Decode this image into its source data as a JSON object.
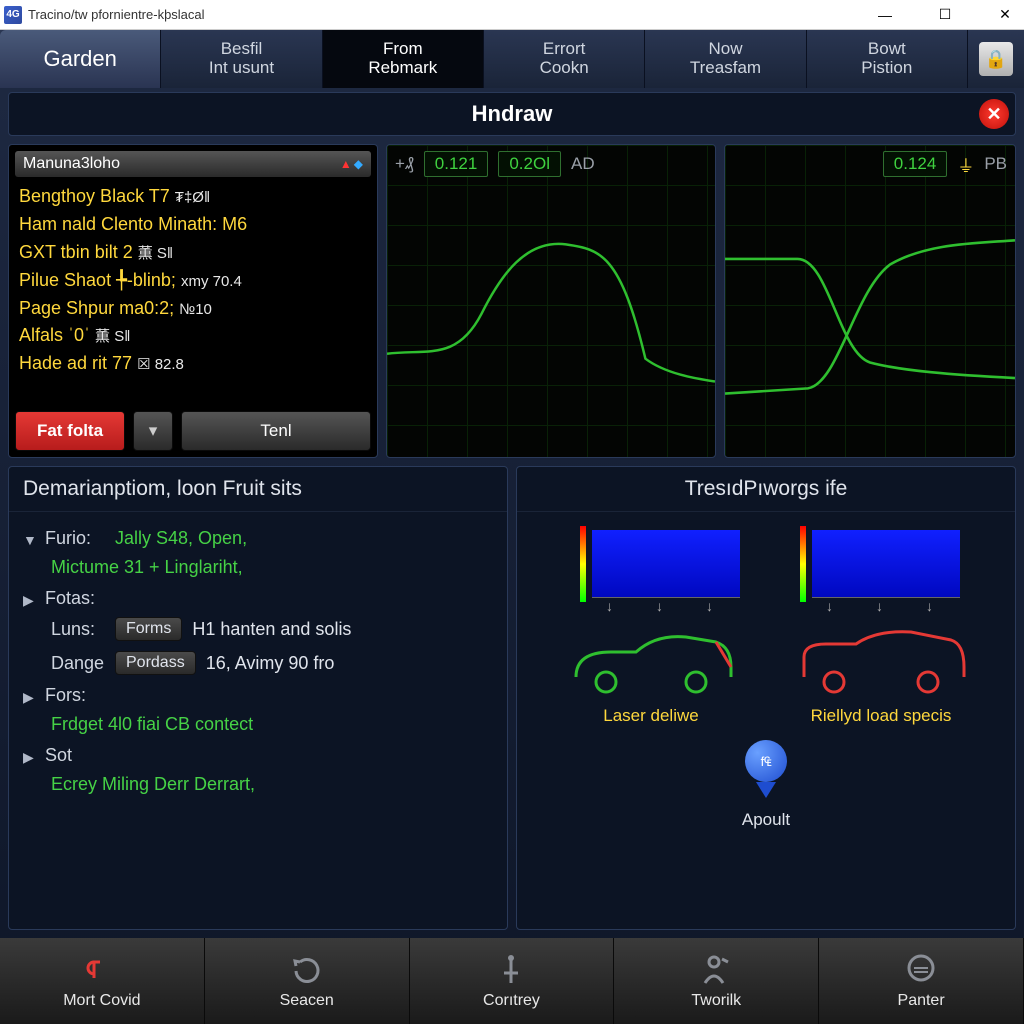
{
  "window": {
    "title": "Tracino/tw pfornientre-kþslacal",
    "icon_text": "4G"
  },
  "tabs": {
    "brand": "Garden",
    "items": [
      {
        "l1": "Besfil",
        "l2": "Int usunt"
      },
      {
        "l1": "From",
        "l2": "Rebmark"
      },
      {
        "l1": "Errort",
        "l2": "Cookn"
      },
      {
        "l1": "Now",
        "l2": "Treasfam"
      },
      {
        "l1": "Bowt",
        "l2": "Pistion"
      }
    ],
    "active_index": 1
  },
  "page_title": "Hndraw",
  "console": {
    "header": "Manuna3loho",
    "lines": [
      {
        "main": "Bengthoy Black T7",
        "tail": "₮‡Ø‖"
      },
      {
        "main": "Ham nald Clento Minath: M6",
        "tail": ""
      },
      {
        "main": "GXT tbin bilt 2",
        "tail": "薫 S‖"
      },
      {
        "main": "Pilue Shaot ╄-blinb;",
        "tail": "xmy 70.4"
      },
      {
        "main": "Page Shpur ma0:2;",
        "tail": "№10"
      },
      {
        "main": "Alfals ˈ0ˈ",
        "tail": "薫 S‖"
      },
      {
        "main": "Hade ad rit 77",
        "tail": "☒ 82.8"
      }
    ],
    "btn_red": "Fat folta",
    "btn_gray": "Tenl"
  },
  "scope1": {
    "prefix": "+₰",
    "v1": "0.121",
    "v2": "0.2Ol",
    "suffix": "AD"
  },
  "scope2": {
    "v1": "0.124",
    "suffix": "PB",
    "icon": "⏚"
  },
  "details": {
    "title": "Demarianptiom, loon Fruit sits",
    "furio_key": "Furio:",
    "furio_val": "Jally S48, Open,",
    "furio_val2": "Mictume 31 + Linglariht,",
    "fotas_key": "Fotas:",
    "luns_key": "Luns:",
    "luns_pill": "Forms",
    "luns_val": "H1 hanten and solis",
    "dange_key": "Dange",
    "dange_pill": "Pordass",
    "dange_val": "16, Avimy 90 fro",
    "fors_key": "Fors:",
    "fors_val": "Frdget  4l0 fiai CB contect",
    "sot_key": "Sot",
    "sot_val": "Ecrey   Miling Derr Derrart,"
  },
  "tres": {
    "title": "TresıdPıworgs ife",
    "car1": "Laser deliwe",
    "car2": "Riellyd load specis",
    "pin_text": "f₠",
    "pin_label": "Apoult"
  },
  "bottom": [
    {
      "label": "Mort Covid"
    },
    {
      "label": "Seacen"
    },
    {
      "label": "Corıtrey"
    },
    {
      "label": "Tworilk"
    },
    {
      "label": "Panter"
    }
  ],
  "chart_data": [
    {
      "type": "line",
      "title": "scope-left",
      "xlim": [
        0,
        100
      ],
      "ylim": [
        0,
        100
      ],
      "series": [
        {
          "name": "trace",
          "values": [
            [
              0,
              60
            ],
            [
              12,
              62
            ],
            [
              22,
              58
            ],
            [
              30,
              72
            ],
            [
              40,
              86
            ],
            [
              55,
              84
            ],
            [
              70,
              82
            ],
            [
              82,
              40
            ],
            [
              92,
              36
            ],
            [
              100,
              34
            ]
          ]
        }
      ]
    },
    {
      "type": "line",
      "title": "scope-right",
      "xlim": [
        0,
        100
      ],
      "ylim": [
        0,
        100
      ],
      "series": [
        {
          "name": "a",
          "values": [
            [
              0,
              70
            ],
            [
              25,
              70
            ],
            [
              40,
              40
            ],
            [
              60,
              36
            ],
            [
              100,
              34
            ]
          ]
        },
        {
          "name": "b",
          "values": [
            [
              0,
              28
            ],
            [
              30,
              30
            ],
            [
              48,
              62
            ],
            [
              70,
              70
            ],
            [
              100,
              72
            ]
          ]
        }
      ]
    }
  ]
}
